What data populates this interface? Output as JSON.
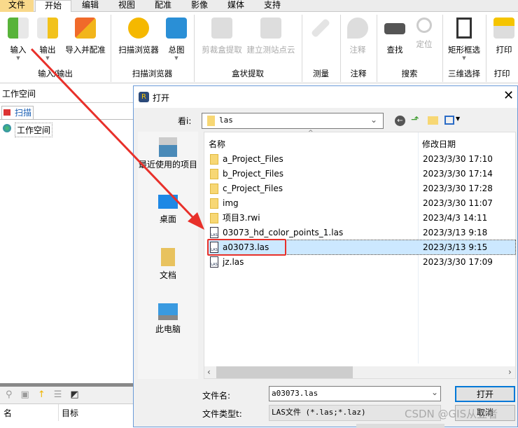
{
  "ribbon": {
    "tabs": [
      "文件",
      "开始",
      "编辑",
      "视图",
      "配准",
      "影像",
      "媒体",
      "支持"
    ],
    "buttons": [
      "输入",
      "输出",
      "导入并配准",
      "扫描浏览器",
      "总图",
      "剪裁盒提取",
      "建立测站点云",
      "注释",
      "查找",
      "定位",
      "矩形框选",
      "打印"
    ],
    "groups": [
      "输入/输出",
      "扫描浏览器",
      "盒状提取",
      "测量",
      "注释",
      "搜索",
      "三维选择",
      "打印"
    ]
  },
  "left_panel": {
    "title": "工作空间",
    "tab": "扫描",
    "tree_item": "工作空间",
    "columns": [
      "名",
      "目标"
    ]
  },
  "dialog": {
    "title": "打开",
    "look_in_label": "看i:",
    "look_in_value": "las",
    "places": [
      "最近使用的项目",
      "桌面",
      "文档",
      "此电脑"
    ],
    "columns": [
      "名称",
      "修改日期"
    ],
    "files": [
      {
        "name": "a_Project_Files",
        "date": "2023/3/30 17:10",
        "type": "folder"
      },
      {
        "name": "b_Project_Files",
        "date": "2023/3/30 17:14",
        "type": "folder"
      },
      {
        "name": "c_Project_Files",
        "date": "2023/3/30 17:28",
        "type": "folder"
      },
      {
        "name": "img",
        "date": "2023/3/30 11:07",
        "type": "folder"
      },
      {
        "name": "项目3.rwi",
        "date": "2023/4/3 14:11",
        "type": "folder"
      },
      {
        "name": "03073_hd_color_points_1.las",
        "date": "2023/3/13 9:18",
        "type": "las"
      },
      {
        "name": "a03073.las",
        "date": "2023/3/13 9:15",
        "type": "las",
        "selected": true
      },
      {
        "name": "jz.las",
        "date": "2023/3/30 17:09",
        "type": "las"
      }
    ],
    "filename_label": "文件名:",
    "filename_value": "a03073.las",
    "filetype_label": "文件类型t:",
    "filetype_value": "LAS文件 (*.las;*.laz)",
    "open_label": "打开",
    "cancel_label": "取消"
  },
  "watermark": "CSDN @GIS从业者",
  "colors": {
    "annotation": "#e8302a",
    "selection": "#cce8ff",
    "file_tab": "#f9d98b"
  }
}
